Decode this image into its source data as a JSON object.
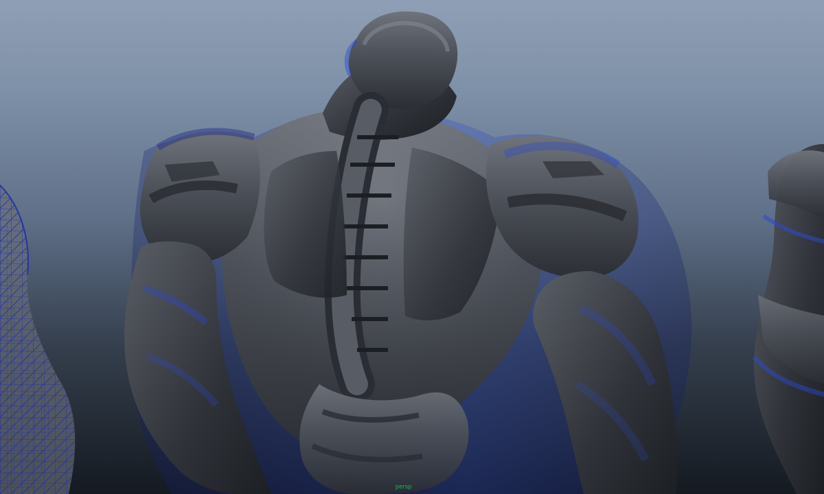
{
  "viewport": {
    "camera_label": "persp",
    "background_colors": [
      "#8f9fb5",
      "#5f7088",
      "#151a21"
    ]
  },
  "scene": {
    "subject": "armored-robot-rear-view-3d-model",
    "shading_colors": [
      "#4b4f57",
      "#2d3036",
      "#1f3bb8",
      "#6b6f77"
    ],
    "wireframe_color": "#1f2fa8"
  }
}
